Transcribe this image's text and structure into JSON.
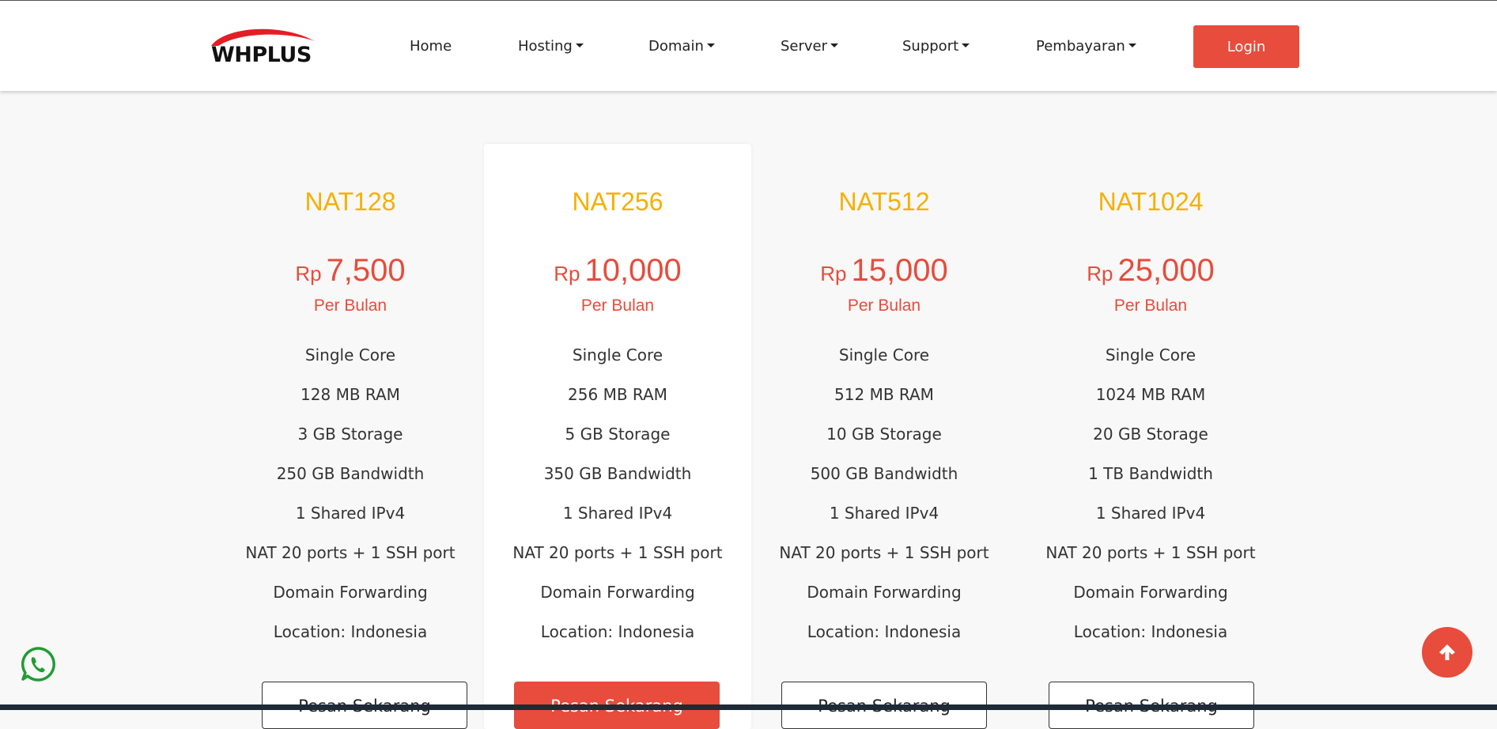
{
  "brand": {
    "name": "WHPLUS",
    "arc_color": "#e31e24"
  },
  "nav": {
    "items": [
      {
        "label": "Home",
        "dropdown": false
      },
      {
        "label": "Hosting",
        "dropdown": true
      },
      {
        "label": "Domain",
        "dropdown": true
      },
      {
        "label": "Server",
        "dropdown": true
      },
      {
        "label": "Support",
        "dropdown": true
      },
      {
        "label": "Pembayaran",
        "dropdown": true
      }
    ],
    "login_label": "Login"
  },
  "colors": {
    "accent": "#e74c3c",
    "plan_name": "#f5b000",
    "background": "#f8f8f8"
  },
  "plans": [
    {
      "name": "NAT128",
      "currency": "Rp",
      "price": "7,500",
      "period": "Per Bulan",
      "features": [
        "Single Core",
        "128 MB RAM",
        "3 GB Storage",
        "250 GB Bandwidth",
        "1 Shared IPv4",
        "NAT 20 ports + 1 SSH port",
        "Domain Forwarding",
        "Location: Indonesia"
      ],
      "button": "Pesan Sekarang",
      "featured": false
    },
    {
      "name": "NAT256",
      "currency": "Rp",
      "price": "10,000",
      "period": "Per Bulan",
      "features": [
        "Single Core",
        "256 MB RAM",
        "5 GB Storage",
        "350 GB Bandwidth",
        "1 Shared IPv4",
        "NAT 20 ports + 1 SSH port",
        "Domain Forwarding",
        "Location: Indonesia"
      ],
      "button": "Pesan Sekarang",
      "featured": true
    },
    {
      "name": "NAT512",
      "currency": "Rp",
      "price": "15,000",
      "period": "Per Bulan",
      "features": [
        "Single Core",
        "512 MB RAM",
        "10 GB Storage",
        "500 GB Bandwidth",
        "1 Shared IPv4",
        "NAT 20 ports + 1 SSH port",
        "Domain Forwarding",
        "Location: Indonesia"
      ],
      "button": "Pesan Sekarang",
      "featured": false
    },
    {
      "name": "NAT1024",
      "currency": "Rp",
      "price": "25,000",
      "period": "Per Bulan",
      "features": [
        "Single Core",
        "1024 MB RAM",
        "20 GB Storage",
        "1 TB Bandwidth",
        "1 Shared IPv4",
        "NAT 20 ports + 1 SSH port",
        "Domain Forwarding",
        "Location: Indonesia"
      ],
      "button": "Pesan Sekarang",
      "featured": false
    }
  ],
  "floating": {
    "whatsapp_icon": "whatsapp-icon",
    "scroll_top_icon": "arrow-up-icon"
  }
}
